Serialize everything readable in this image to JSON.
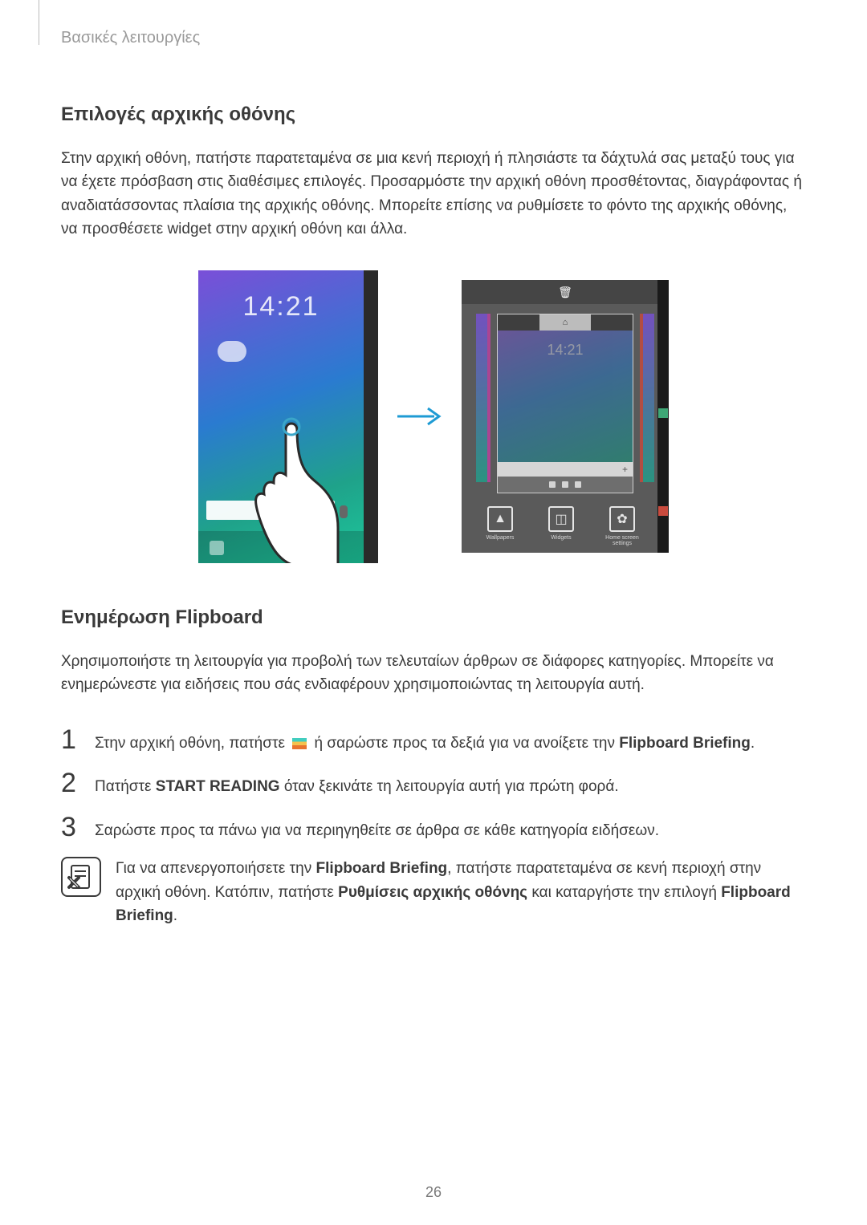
{
  "header": {
    "running": "Βασικές λειτουργίες"
  },
  "section1": {
    "title": "Επιλογές αρχικής οθόνης",
    "body": "Στην αρχική οθόνη, πατήστε παρατεταμένα σε μια κενή περιοχή ή πλησιάστε τα δάχτυλά σας μεταξύ τους για να έχετε πρόσβαση στις διαθέσιμες επιλογές. Προσαρμόστε την αρχική οθόνη προσθέτοντας, διαγράφοντας ή αναδιατάσσοντας πλαίσια της αρχικής οθόνης. Μπορείτε επίσης να ρυθμίσετε το φόντο της αρχικής οθόνης, να προσθέσετε widget στην αρχική οθόνη και άλλα."
  },
  "figure": {
    "clock": "14:21",
    "options": [
      "Wallpapers",
      "Widgets",
      "Home screen settings"
    ]
  },
  "section2": {
    "title": "Ενημέρωση Flipboard",
    "body": "Χρησιμοποιήστε τη λειτουργία για προβολή των τελευταίων άρθρων σε διάφορες κατηγορίες. Μπορείτε να ενημερώνεστε για ειδήσεις που σάς ενδιαφέρουν χρησιμοποιώντας τη λειτουργία αυτή."
  },
  "steps": {
    "s1a": "Στην αρχική οθόνη, πατήστε ",
    "s1b": " ή σαρώστε προς τα δεξιά για να ανοίξετε την ",
    "s1bold": "Flipboard Briefing",
    "s1c": ".",
    "s2a": "Πατήστε ",
    "s2bold": "START READING",
    "s2b": " όταν ξεκινάτε τη λειτουργία αυτή για πρώτη φορά.",
    "s3": "Σαρώστε προς τα πάνω για να περιηγηθείτε σε άρθρα σε κάθε κατηγορία ειδήσεων."
  },
  "note": {
    "a": "Για να απενεργοποιήσετε την ",
    "b1": "Flipboard Briefing",
    "c": ", πατήστε παρατεταμένα σε κενή περιοχή στην αρχική οθόνη. Κατόπιν, πατήστε ",
    "b2": "Ρυθμίσεις αρχικής οθόνης",
    "d": " και καταργήστε την επιλογή ",
    "b3": "Flipboard Briefing",
    "e": "."
  },
  "page_number": "26"
}
